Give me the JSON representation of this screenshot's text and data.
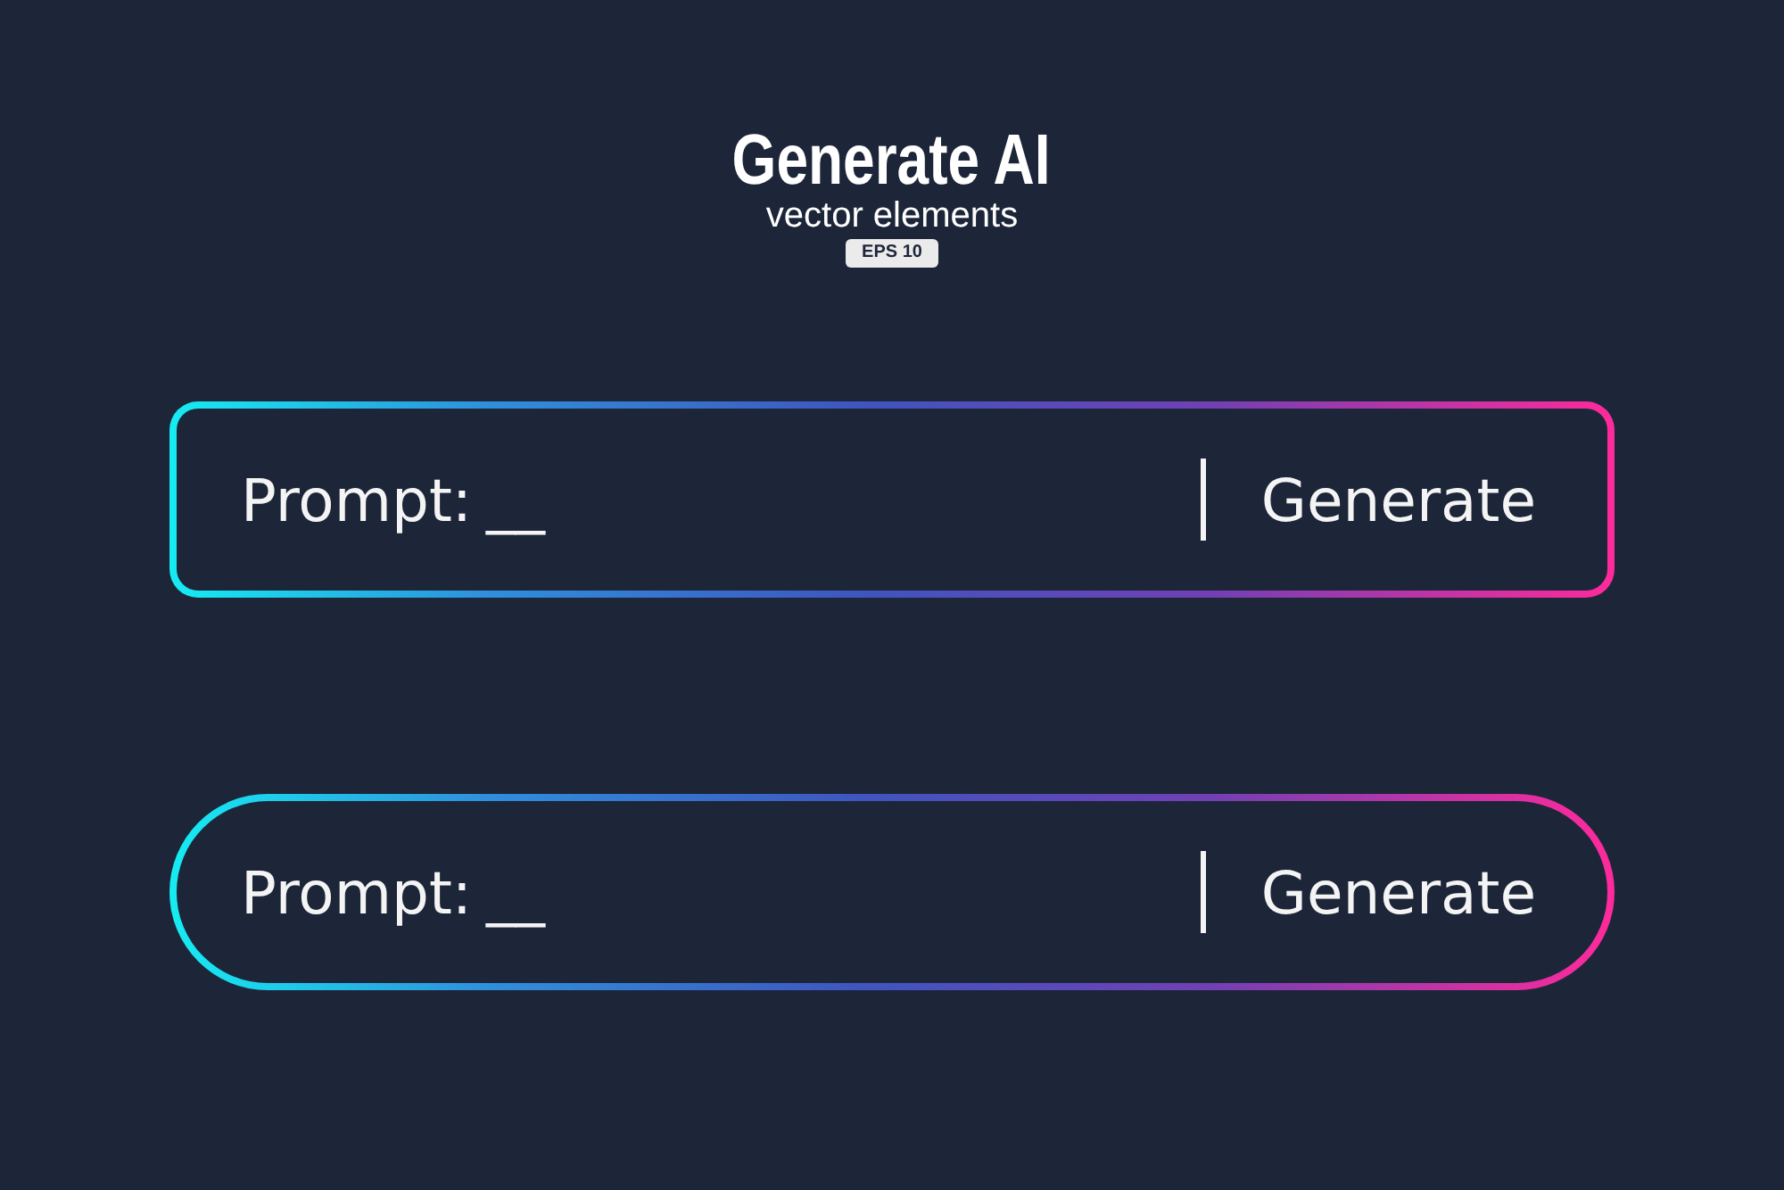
{
  "header": {
    "title": "Generate AI",
    "subtitle": "vector elements",
    "badge": "EPS 10"
  },
  "prompt_bars": [
    {
      "kind": "rounded",
      "label": "Prompt:",
      "blank": "__",
      "button": "Generate"
    },
    {
      "kind": "pill",
      "label": "Prompt:",
      "blank": "__",
      "button": "Generate"
    }
  ]
}
